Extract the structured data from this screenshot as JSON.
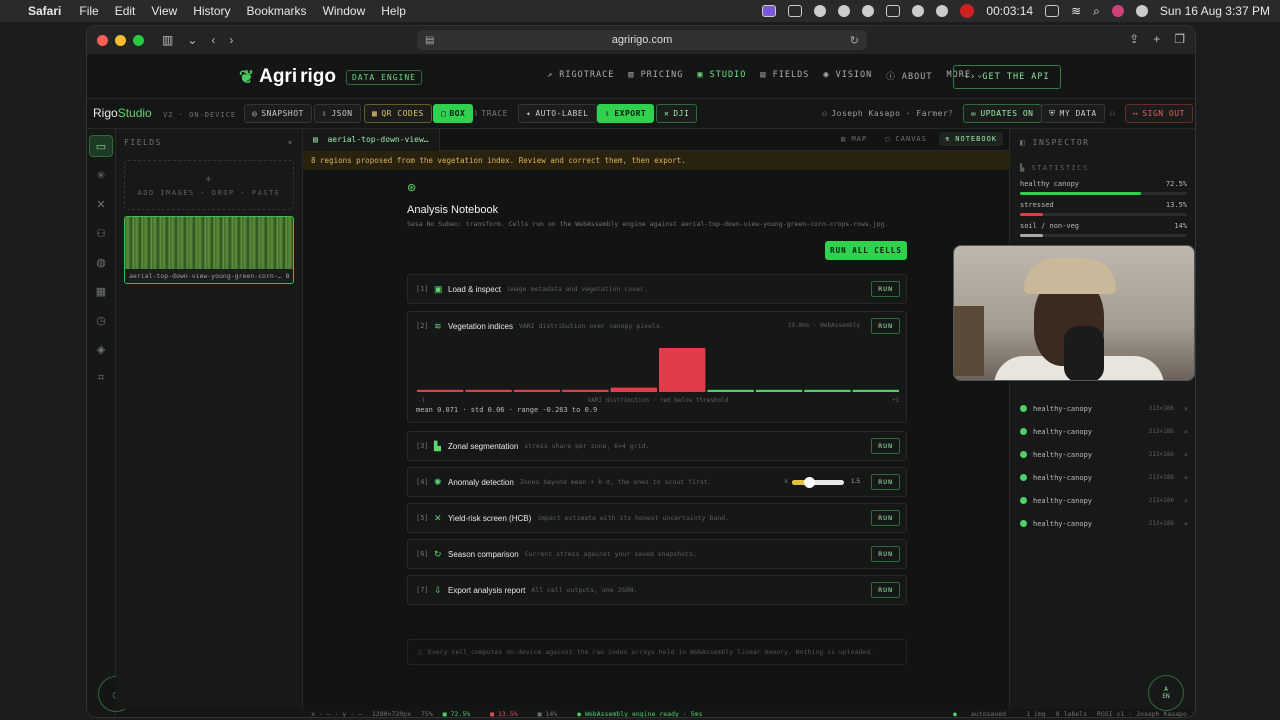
{
  "menubar": {
    "app": "Safari",
    "items": [
      "File",
      "Edit",
      "View",
      "History",
      "Bookmarks",
      "Window",
      "Help"
    ],
    "timer": "00:03:14",
    "datetime": "Sun 16 Aug  3:37 PM"
  },
  "browser": {
    "url": "agririgo.com"
  },
  "site": {
    "logo_a": "Agri",
    "logo_b": "rigo",
    "badge": "DATA ENGINE",
    "nav": [
      "RIGOTRACE",
      "PRICING",
      "STUDIO",
      "FIELDS",
      "VISION",
      "ABOUT",
      "MORE"
    ],
    "api_button": "GET THE API"
  },
  "app": {
    "title_a": "Rigo",
    "title_b": "Studio",
    "version": "V2 · ON-DEVICE",
    "tools": [
      "SNAPSHOT",
      "JSON",
      "QR CODES",
      "BOX",
      "TRACE",
      "AUTO-LABEL",
      "EXPORT",
      "DJI"
    ],
    "user": "Joseph Kasapo · Farmer",
    "updates": "UPDATES ON",
    "my_data": "MY DATA",
    "sign_out": "SIGN OUT"
  },
  "fields": {
    "header": "FIELDS",
    "drop_plus": "+",
    "drop_text": "ADD IMAGES · DROP · PASTE",
    "thumb_caption": "aerial-top-down-view-young-green-corn-… 8"
  },
  "center": {
    "doc_tab": "aerial-top-down-view…",
    "view_tabs": [
      "MAP",
      "CANVAS",
      "NOTEBOOK"
    ],
    "banner": "8 regions proposed from the vegetation index. Review and correct them, then export.",
    "nb_title": "Analysis Notebook",
    "nb_sub": "Sesa No Suban: transform. Cells run on the WebAssembly engine against aerial-top-down-view-young-green-corn-crops-rows.jpg.",
    "run_all": "RUN ALL CELLS",
    "run": "RUN",
    "cells": [
      {
        "num": "[1]",
        "title": "Load & inspect",
        "desc": "image metadata and vegetation cover."
      },
      {
        "num": "[2]",
        "title": "Vegetation indices",
        "desc": "VARI distribution over canopy pixels.",
        "meta": "19.0ms · WebAssembly"
      },
      {
        "num": "[3]",
        "title": "Zonal segmentation",
        "desc": "stress share per zone, 6×4 grid."
      },
      {
        "num": "[4]",
        "title": "Anomaly detection",
        "desc": "Zones beyond mean + k·σ, the ones to scout first.",
        "k_label": "k",
        "k_value": "1.5"
      },
      {
        "num": "[5]",
        "title": "Yield-risk screen (HCB)",
        "desc": "impact estimate with its honest uncertainty band."
      },
      {
        "num": "[6]",
        "title": "Season comparison",
        "desc": "Current stress against your saved snapshots."
      },
      {
        "num": "[7]",
        "title": "Export analysis report",
        "desc": "All cell outputs, one JSON."
      }
    ],
    "stats_line": "mean 0.071 · std 0.06 · range -0.263 to 0.9",
    "footnote": "Every cell computes on-device against the raw index arrays held in WebAssembly linear memory. Nothing is uploaded."
  },
  "chart_data": {
    "type": "bar",
    "xlabel": "VARI distribution · red below threshold",
    "tick_left": "-1",
    "tick_right": "+1",
    "values": [
      1,
      1,
      1,
      1,
      2,
      20,
      1,
      1,
      1,
      1
    ],
    "colors": [
      "#e03d4a",
      "#e03d4a",
      "#e03d4a",
      "#e03d4a",
      "#e03d4a",
      "#e03d4a",
      "#4fd06a",
      "#4fd06a",
      "#4fd06a",
      "#4fd06a"
    ]
  },
  "inspector": {
    "header": "INSPECTOR",
    "statistics": "STATISTICS",
    "stats": [
      {
        "label": "healthy canopy",
        "value": "72.5%",
        "frac": 0.725,
        "color": "#30d14f"
      },
      {
        "label": "stressed",
        "value": "13.5%",
        "frac": 0.135,
        "color": "#e03d4a"
      },
      {
        "label": "soil / non-veg",
        "value": "14%",
        "frac": 0.14,
        "color": "#aaaaaa"
      }
    ],
    "regions": [
      {
        "label": "healthy-canopy",
        "size": "213×186"
      },
      {
        "label": "healthy-canopy",
        "size": "213×186"
      },
      {
        "label": "healthy-canopy",
        "size": "213×186"
      },
      {
        "label": "healthy-canopy",
        "size": "213×186"
      },
      {
        "label": "healthy-canopy",
        "size": "213×186"
      },
      {
        "label": "healthy-canopy",
        "size": "213×186"
      }
    ],
    "lang_a": "A",
    "lang_b": "EN"
  },
  "statusbar": {
    "coords": "x · — · y · —",
    "dims": "1280×720px",
    "zoom": "75%",
    "healthy": "72.5%",
    "stressed": "13.5%",
    "soil": "14%",
    "engine": "WebAssembly engine ready · 5ms",
    "saved": "autosaved",
    "imgs": "1 img",
    "labels": "8 labels",
    "owner": "RGSI v1 · Joseph Kasapo"
  }
}
